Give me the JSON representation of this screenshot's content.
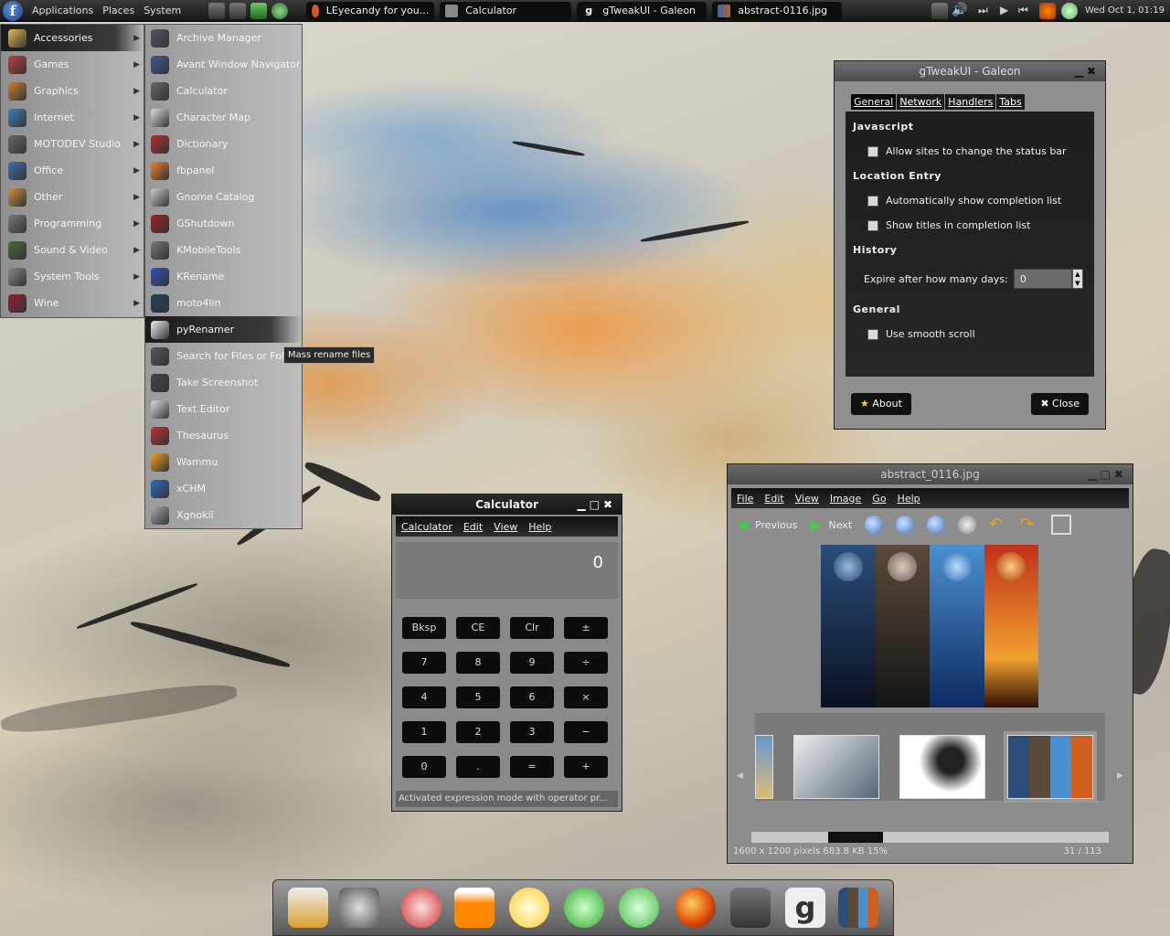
{
  "top_panel": {
    "menus": [
      "Applications",
      "Places",
      "System"
    ],
    "tasks": [
      "LEyecandy for you...",
      "Calculator",
      "gTweakUI - Galeon",
      "abstract-0116.jpg"
    ],
    "clock": "Wed Oct 1, 01:19"
  },
  "apps_menu": {
    "items": [
      {
        "label": "Accessories",
        "icon": "accessories-icon",
        "color": "#e0c050"
      },
      {
        "label": "Games",
        "icon": "games-icon",
        "color": "#c04040"
      },
      {
        "label": "Graphics",
        "icon": "graphics-icon",
        "color": "#d08030"
      },
      {
        "label": "Internet",
        "icon": "internet-icon",
        "color": "#3a80c0"
      },
      {
        "label": "MOTODEV Studio",
        "icon": "folder-icon",
        "color": "#6a6a6a"
      },
      {
        "label": "Office",
        "icon": "office-icon",
        "color": "#4070b0"
      },
      {
        "label": "Other",
        "icon": "other-icon",
        "color": "#d09040"
      },
      {
        "label": "Programming",
        "icon": "programming-icon",
        "color": "#7a7a7a"
      },
      {
        "label": "Sound & Video",
        "icon": "sound-video-icon",
        "color": "#4a6a3a"
      },
      {
        "label": "System Tools",
        "icon": "system-tools-icon",
        "color": "#888888"
      },
      {
        "label": "Wine",
        "icon": "wine-icon",
        "color": "#902030"
      }
    ]
  },
  "sub_menu": {
    "items": [
      {
        "label": "Archive Manager",
        "icon": "archive-icon",
        "color": "#556"
      },
      {
        "label": "Avant Window Navigator",
        "icon": "awn-icon",
        "color": "#3a5a9a"
      },
      {
        "label": "Calculator",
        "icon": "calculator-icon",
        "color": "#666"
      },
      {
        "label": "Character Map",
        "icon": "character-map-icon",
        "color": "#ddd"
      },
      {
        "label": "Dictionary",
        "icon": "dictionary-icon",
        "color": "#b03030"
      },
      {
        "label": "fbpanel",
        "icon": "fbpanel-icon",
        "color": "#f08030"
      },
      {
        "label": "Gnome Catalog",
        "icon": "catalog-icon",
        "color": "#ccc"
      },
      {
        "label": "GShutdown",
        "icon": "shutdown-icon",
        "color": "#a02020"
      },
      {
        "label": "KMobileTools",
        "icon": "mobile-icon",
        "color": "#777"
      },
      {
        "label": "KRename",
        "icon": "krename-icon",
        "color": "#3050c0"
      },
      {
        "label": "moto4lin",
        "icon": "moto4lin-icon",
        "color": "#204060"
      },
      {
        "label": "pyRenamer",
        "icon": "pyrenamer-icon",
        "color": "#eee"
      },
      {
        "label": "Search for Files or Fold",
        "icon": "search-icon",
        "color": "#555"
      },
      {
        "label": "Take Screenshot",
        "icon": "camera-icon",
        "color": "#444"
      },
      {
        "label": "Text Editor",
        "icon": "text-editor-icon",
        "color": "#ddd"
      },
      {
        "label": "Thesaurus",
        "icon": "thesaurus-icon",
        "color": "#c03030"
      },
      {
        "label": "Wammu",
        "icon": "wammu-icon",
        "color": "#f0a020"
      },
      {
        "label": "xCHM",
        "icon": "xchm-icon",
        "color": "#2a70c0"
      },
      {
        "label": "Xgnokii",
        "icon": "xgnokii-icon",
        "color": "#aaa"
      }
    ],
    "tooltip": "Mass rename files"
  },
  "gtweak": {
    "title": "gTweakUI - Galeon",
    "tabs": [
      "General",
      "Network",
      "Handlers",
      "Tabs"
    ],
    "sections": {
      "javascript": "Javascript",
      "js_status": "Allow sites to change the status bar",
      "location": "Location Entry",
      "auto_complete": "Automatically show completion list",
      "show_titles": "Show titles in completion list",
      "history": "History",
      "expire_label": "Expire after how many days:",
      "expire_value": "0",
      "general": "General",
      "smooth_scroll": "Use smooth scroll"
    },
    "about": "About",
    "close": "Close"
  },
  "calculator": {
    "title": "Calculator",
    "menus": [
      "Calculator",
      "Edit",
      "View",
      "Help"
    ],
    "display": "0",
    "keys": [
      "Bksp",
      "CE",
      "Clr",
      "±",
      "7",
      "8",
      "9",
      "÷",
      "4",
      "5",
      "6",
      "×",
      "1",
      "2",
      "3",
      "−",
      "0",
      ".",
      "=",
      "+"
    ],
    "status": "Activated expression mode with operator pr..."
  },
  "viewer": {
    "title": "abstract_0116.jpg",
    "menus": [
      "File",
      "Edit",
      "View",
      "Image",
      "Go",
      "Help"
    ],
    "previous": "Previous",
    "next": "Next",
    "status_left": "1600 x 1200 pixels  683.8 KB   15%",
    "status_right": "31 / 113"
  }
}
